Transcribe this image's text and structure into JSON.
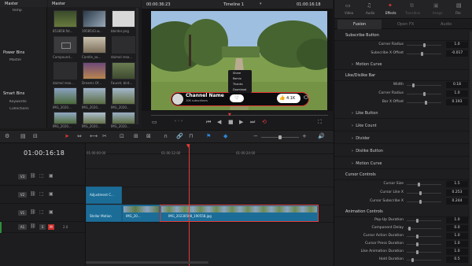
{
  "left_panel": {
    "master": "Master",
    "temp": "temp",
    "power_bins_header": "Power Bins",
    "power_master": "Master",
    "smart_bins_header": "Smart Bins",
    "keywords": "Keywords",
    "collections": "Collections"
  },
  "media_pool": {
    "header": "Master",
    "items": [
      {
        "label": "853858.fid..."
      },
      {
        "label": "1958543.w..."
      },
      {
        "label": "bbirder.png"
      },
      {
        "label": "Compound..."
      },
      {
        "label": "Corelle_sa..."
      },
      {
        "label": "daimol reso..."
      },
      {
        "label": "daimol reso..."
      },
      {
        "label": "Dreams Of..."
      },
      {
        "label": "Faucet, bird..."
      },
      {
        "label": "IMG_2020..."
      },
      {
        "label": "IMG_2020..."
      },
      {
        "label": "IMG_2020..."
      },
      {
        "label": "IMG_2020..."
      },
      {
        "label": "IMG_2020..."
      },
      {
        "label": "IMG_2020..."
      }
    ]
  },
  "viewer": {
    "timecode": "00:00:36:23",
    "timeline_name": "Timeline 1",
    "current_time": "01:00:16:18",
    "channel_name": "Channel Name",
    "channel_sub": "10K subscribers",
    "like_count": "4.1K",
    "menu_items": [
      "Share",
      "Remix",
      "Thanks",
      "Download"
    ]
  },
  "inspector": {
    "tabs": [
      "Video",
      "Audio",
      "Effects",
      "Transition",
      "Image",
      "File"
    ],
    "active_tab": "Effects",
    "subtabs": [
      "Fusion",
      "Open FX",
      "Audio"
    ],
    "subscribe_button_header": "Subscribe Button",
    "corner_radius_label": "Corner Radius",
    "corner_radius_value": "1.0",
    "subscribe_x_label": "Subscribe X Offset",
    "subscribe_x_value": "-0.017",
    "motion_curve_1": "Motion Curve",
    "like_bar_header": "Like/Dislike Bar",
    "width_label": "Width",
    "width_value": "0.18",
    "corner_radius2_label": "Corner Radius",
    "corner_radius2_value": "1.0",
    "bar_x_label": "Bar X Offset",
    "bar_x_value": "0.193",
    "like_button": "Like Button",
    "like_count": "Like Count",
    "divider": "Divider",
    "dislike_button": "Dislike Button",
    "motion_curve_2": "Motion Curve",
    "cursor_controls_header": "Cursor Controls",
    "cursor_size_label": "Cursor Size",
    "cursor_size_value": "1.5",
    "cursor_like_x_label": "Cursor Like X",
    "cursor_like_x_value": "0.253",
    "cursor_sub_x_label": "Cursor Subscribe X",
    "cursor_sub_x_value": "0.244",
    "anim_controls_header": "Animation Controls",
    "popup_label": "Pop-Up Duration",
    "popup_value": "1.0",
    "comp_delay_label": "Component Delay",
    "comp_delay_value": "0.0",
    "cursor_action_label": "Cursor Action Duration",
    "cursor_action_value": "1.0",
    "cursor_press_label": "Cursor Press Duration",
    "cursor_press_value": "1.0",
    "like_anim_label": "Like Animation Duration",
    "like_anim_value": "1.0",
    "hold_label": "Hold Duration",
    "hold_value": "0.5",
    "slider_levels": {
      "corner_radius": 0.5,
      "subscribe_x": 0.45,
      "width": 0.18,
      "corner_radius2": 0.5,
      "bar_x": 0.55,
      "cursor_size": 0.35,
      "cursor_like_x": 0.4,
      "cursor_sub_x": 0.38,
      "popup": 0.3,
      "comp_delay": 0.05,
      "cursor_action": 0.3,
      "cursor_press": 0.3,
      "like_anim": 0.3,
      "hold": 0.15
    }
  },
  "timeline": {
    "timecode": "01:00:16:18",
    "ruler": [
      "01:00:00:00",
      "01:00:12:00",
      "01:00:24:00"
    ],
    "tracks": [
      "V3",
      "V2",
      "V1",
      "A1"
    ],
    "a1_value": "2.0",
    "clip_adjustment": "Adjustment C...",
    "clip_stellar": "Stellar Motion",
    "clip_img_short": "IMG_20...",
    "clip_img_long": "IMG_20230508_190558.jpg"
  },
  "colors": {
    "accent": "#e6392f",
    "clip_blue": "#1b6d98",
    "playhead": "#e53a35"
  }
}
